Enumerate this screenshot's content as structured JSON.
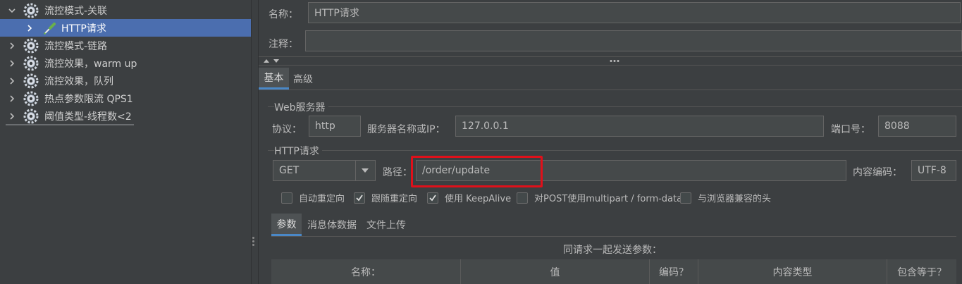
{
  "tree": {
    "items": [
      {
        "label": "流控模式-关联",
        "expanded": true,
        "icon": "gear-icon"
      },
      {
        "label": "HTTP请求",
        "selected": true,
        "icon": "pipette-icon"
      },
      {
        "label": "流控模式-链路",
        "icon": "gear-icon"
      },
      {
        "label": "流控效果，warm up",
        "icon": "gear-icon"
      },
      {
        "label": "流控效果，队列",
        "icon": "gear-icon"
      },
      {
        "label": "热点参数限流 QPS1",
        "icon": "gear-icon"
      },
      {
        "label": "阈值类型-线程数<2",
        "icon": "gear-icon"
      }
    ]
  },
  "form": {
    "name_label": "名称：",
    "name_value": "HTTP请求",
    "comment_label": "注释：",
    "comment_value": ""
  },
  "tabs": {
    "basic": "基本",
    "advanced": "高级"
  },
  "web_server": {
    "title": "Web服务器",
    "protocol_label": "协议：",
    "protocol_value": "http",
    "server_label": "服务器名称或IP：",
    "server_value": "127.0.0.1",
    "port_label": "端口号：",
    "port_value": "8088"
  },
  "http_request": {
    "title": "HTTP请求",
    "method_value": "GET",
    "path_label": "路径：",
    "path_value": "/order/update",
    "encoding_label": "内容编码：",
    "encoding_value": "UTF-8"
  },
  "options": [
    {
      "label": "自动重定向",
      "checked": false
    },
    {
      "label": "跟随重定向",
      "checked": true
    },
    {
      "label": "使用 KeepAlive",
      "checked": true
    },
    {
      "label": "对POST使用multipart / form-data",
      "checked": false
    },
    {
      "label": "与浏览器兼容的头",
      "checked": false
    }
  ],
  "sub_tabs": {
    "params": "参数",
    "body": "消息体数据",
    "files": "文件上传"
  },
  "params_table": {
    "caption": "同请求一起发送参数：",
    "headers": [
      "名称：",
      "值",
      "编码？",
      "内容类型",
      "包含等于？"
    ]
  },
  "colors": {
    "background": "#3c3f41",
    "selection": "#4b6eaf",
    "field_bg": "#45494a",
    "highlight": "#e0101a"
  }
}
